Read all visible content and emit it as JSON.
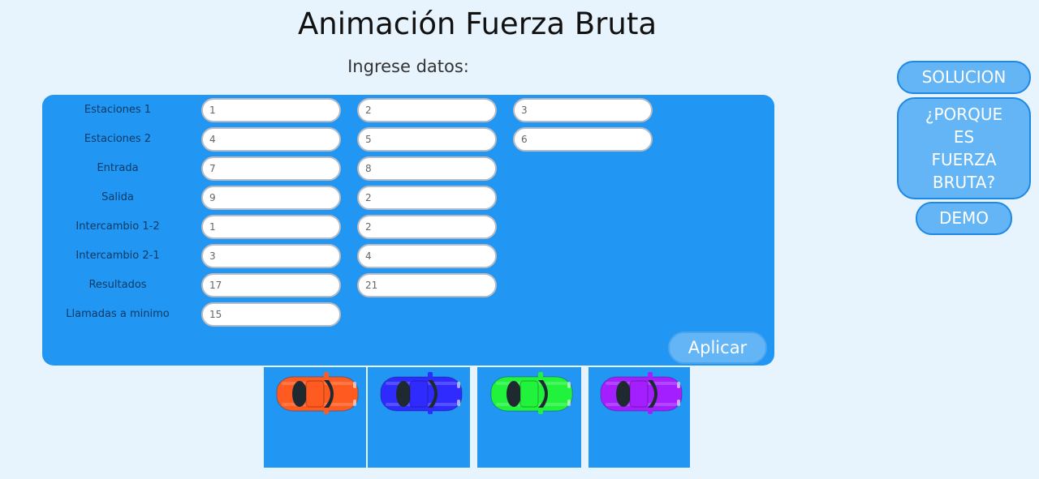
{
  "page": {
    "title": "Animación Fuerza Bruta",
    "subtitle": "Ingrese datos:"
  },
  "form": {
    "rows": [
      {
        "label": "Estaciones 1",
        "values": [
          "1",
          "2",
          "3"
        ]
      },
      {
        "label": "Estaciones 2",
        "values": [
          "4",
          "5",
          "6"
        ]
      },
      {
        "label": "Entrada",
        "values": [
          "7",
          "8"
        ]
      },
      {
        "label": "Salida",
        "values": [
          "9",
          "2"
        ]
      },
      {
        "label": "Intercambio 1-2",
        "values": [
          "1",
          "2"
        ]
      },
      {
        "label": "Intercambio 2-1",
        "values": [
          "3",
          "4"
        ]
      },
      {
        "label": "Resultados",
        "values": [
          "17",
          "21"
        ]
      },
      {
        "label": "Llamadas a minimo",
        "values": [
          "15"
        ]
      }
    ],
    "apply_label": "Aplicar"
  },
  "side_buttons": {
    "solucion": "SOLUCION",
    "porque_lines": [
      "¿PORQUE",
      "ES",
      "FUERZA",
      "BRUTA?"
    ],
    "demo": "DEMO"
  },
  "cars": [
    {
      "name": "car-orange",
      "color": "#ff5a1f"
    },
    {
      "name": "car-blue",
      "color": "#2f2bff"
    },
    {
      "name": "car-green",
      "color": "#21f23c"
    },
    {
      "name": "car-purple",
      "color": "#a31fff"
    }
  ],
  "colors": {
    "page_background": "#e8f4fd",
    "panel": "#2196f3",
    "button": "#64b5f6",
    "button_border": "#1e88e5"
  }
}
